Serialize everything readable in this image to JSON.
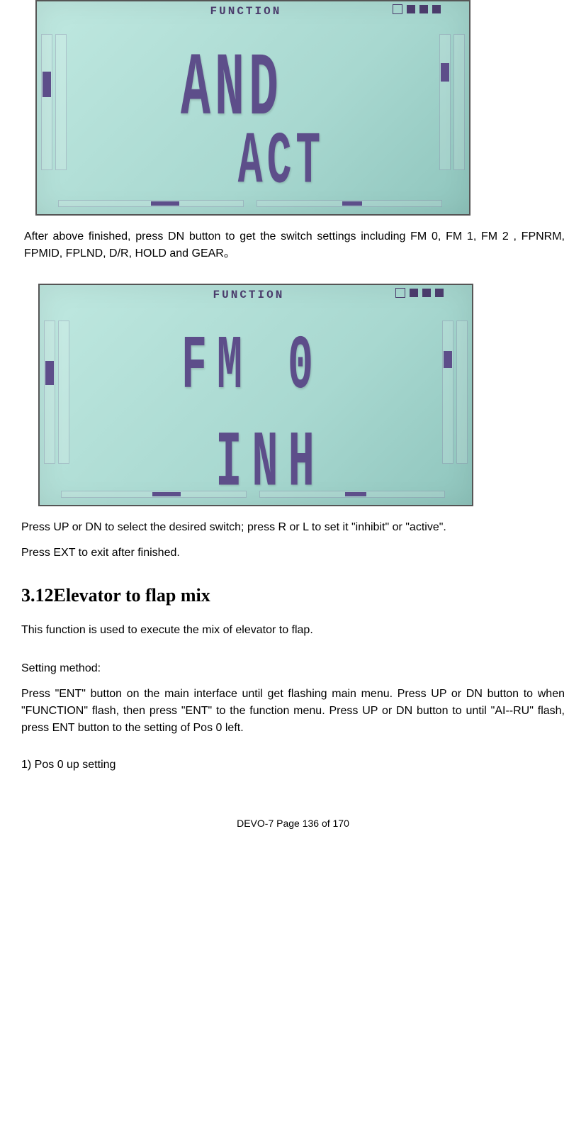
{
  "lcd1": {
    "label": "FUNCTION",
    "row1": "AND",
    "row2": "ACT"
  },
  "para1": "After above finished, press DN button to get the switch settings including FM 0, FM 1, FM 2 , FPNRM, FPMID, FPLND, D/R, HOLD and GEAR。",
  "lcd2": {
    "label": "FUNCTION",
    "row1": "FM  0",
    "row2": "INH"
  },
  "para2": "Press UP or DN to select the desired switch; press R or L to set it \"inhibit\" or \"active\".",
  "para3": "Press EXT to exit after finished.",
  "section_title": "3.12Elevator to flap mix",
  "para4": "This function is used to execute the mix of elevator to flap.",
  "para5": "Setting method:",
  "para6": "Press \"ENT\" button on the main interface until get flashing main menu. Press UP or DN button to when \"FUNCTION\" flash, then press \"ENT\" to the function menu. Press UP or DN button to until \"AI--RU\" flash, press ENT button to the setting of Pos 0 left.",
  "list1": "1)   Pos 0 up setting",
  "footer": "DEVO-7     Page 136 of 170"
}
